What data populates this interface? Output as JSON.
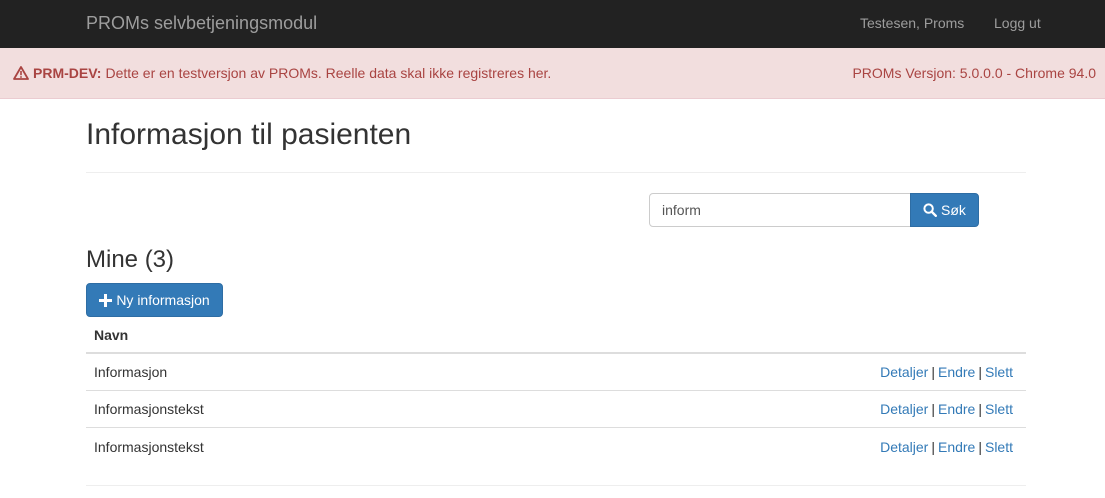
{
  "navbar": {
    "brand": "PROMs selvbetjeningsmodul",
    "user": "Testesen, Proms",
    "logout": "Logg ut"
  },
  "alert": {
    "icon": "warning-icon",
    "tag": "PRM-DEV:",
    "message": "Dette er en testversjon av PROMs. Reelle data skal ikke registreres her.",
    "version": "PROMs Versjon: 5.0.0.0 - Chrome 94.0"
  },
  "page": {
    "title": "Informasjon til pasienten"
  },
  "search": {
    "value": "inform",
    "button_label": "Søk",
    "icon": "search-icon"
  },
  "section": {
    "title": "Mine (3)",
    "add_button_label": "Ny informasjon",
    "add_icon": "plus-icon"
  },
  "table": {
    "header_name": "Navn",
    "separator": "|",
    "rows": [
      {
        "name": "Informasjon",
        "details": "Detaljer",
        "edit": "Endre",
        "delete": "Slett"
      },
      {
        "name": "Informasjonstekst",
        "details": "Detaljer",
        "edit": "Endre",
        "delete": "Slett"
      },
      {
        "name": "Informasjonstekst",
        "details": "Detaljer",
        "edit": "Endre",
        "delete": "Slett"
      }
    ]
  },
  "colors": {
    "navbar_bg": "#222222",
    "alert_bg": "#f2dede",
    "alert_text": "#a94442",
    "primary": "#337ab7",
    "link": "#337ab7"
  }
}
